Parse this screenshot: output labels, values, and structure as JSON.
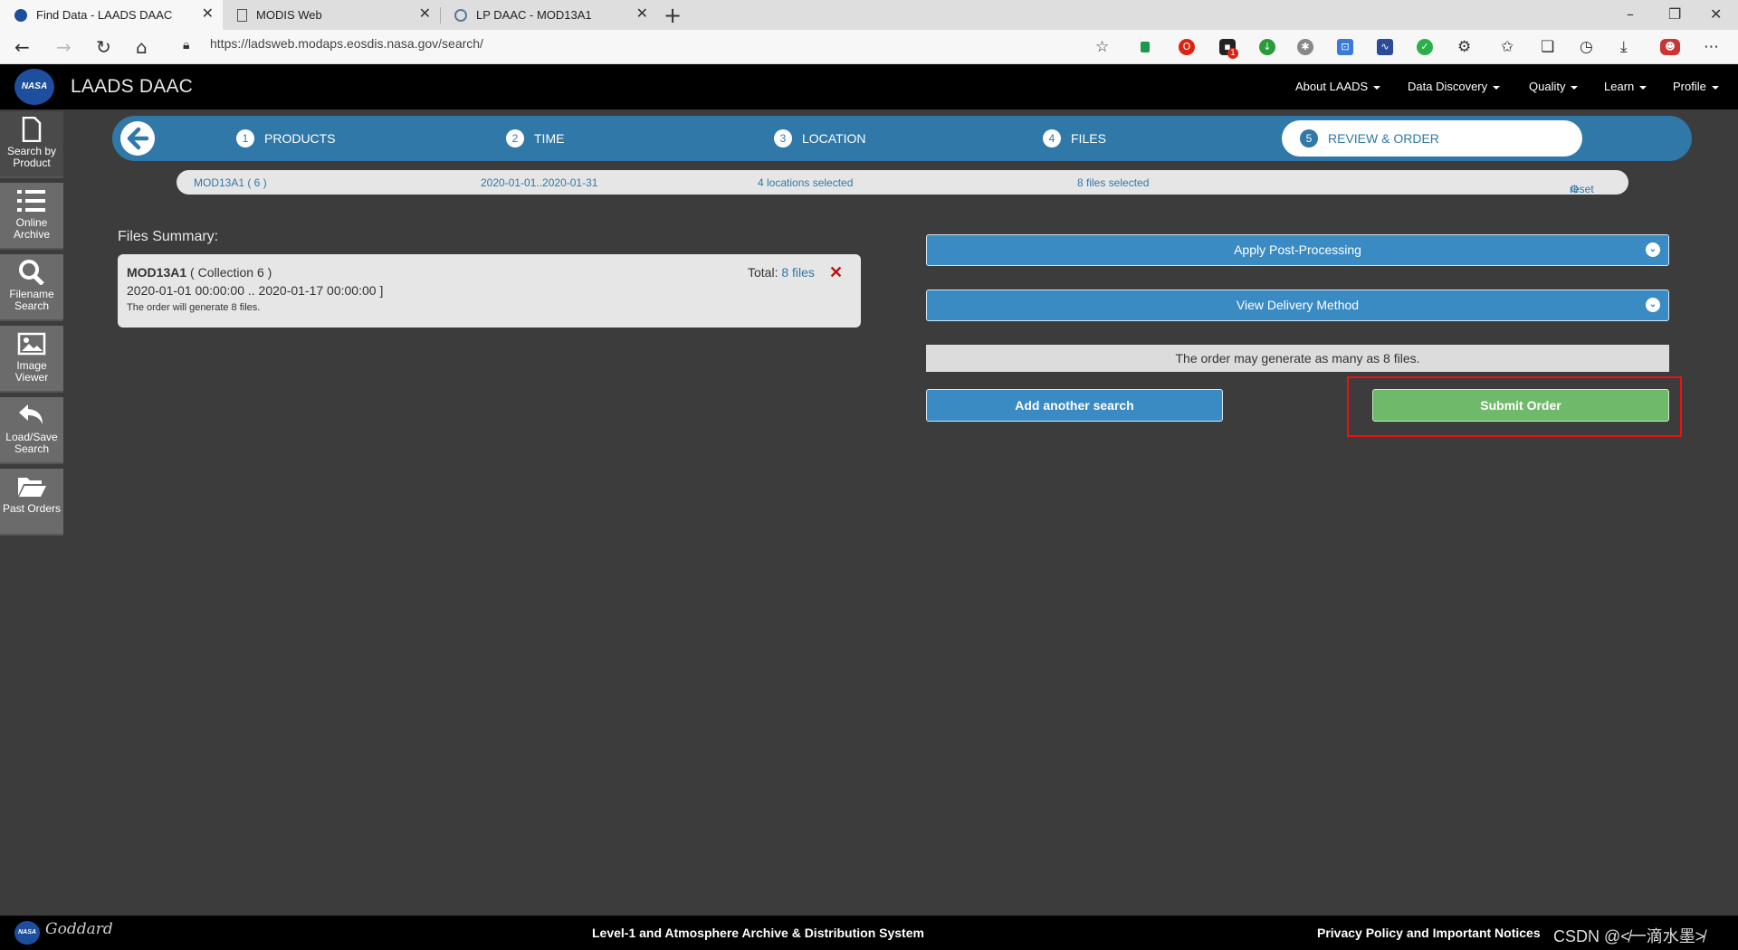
{
  "browser": {
    "tabs": [
      {
        "title": "Find Data - LAADS DAAC",
        "active": true
      },
      {
        "title": "MODIS Web",
        "active": false
      },
      {
        "title": "LP DAAC - MOD13A1",
        "active": false
      }
    ],
    "url": "https://ladsweb.modaps.eosdis.nasa.gov/search/",
    "ext_badge": "1"
  },
  "header": {
    "logo_text": "NASA",
    "title": "LAADS DAAC",
    "nav": [
      "About LAADS",
      "Data Discovery",
      "Quality",
      "Learn",
      "Profile"
    ]
  },
  "sidebar": {
    "items": [
      {
        "label": "Search by Product",
        "icon": "document-icon"
      },
      {
        "label": "Online Archive",
        "icon": "list-icon"
      },
      {
        "label": "Filename Search",
        "icon": "search-icon"
      },
      {
        "label": "Image Viewer",
        "icon": "image-icon"
      },
      {
        "label": "Load/Save Search",
        "icon": "undo-icon"
      },
      {
        "label": "Past Orders",
        "icon": "folder-icon"
      }
    ]
  },
  "steps": [
    {
      "num": "1",
      "label": "PRODUCTS"
    },
    {
      "num": "2",
      "label": "TIME"
    },
    {
      "num": "3",
      "label": "LOCATION"
    },
    {
      "num": "4",
      "label": "FILES"
    },
    {
      "num": "5",
      "label": "REVIEW & ORDER"
    }
  ],
  "summary": {
    "product": "MOD13A1 ( 6 )",
    "time": "2020-01-01..2020-01-31",
    "locations": "4 locations selected",
    "files": "8 files selected",
    "reset": "reset"
  },
  "files_summary": {
    "title": "Files Summary:",
    "product": "MOD13A1",
    "collection": "( Collection 6 )",
    "range": "2020-01-01 00:00:00 .. 2020-01-17 00:00:00 ]",
    "note": "The order will generate 8 files.",
    "total_label": "Total:",
    "total_link": "8 files"
  },
  "right": {
    "post_processing": "Apply Post-Processing",
    "delivery": "View Delivery Method",
    "order_note": "The order may generate as many as 8 files.",
    "add_search": "Add another search",
    "submit": "Submit Order"
  },
  "footer": {
    "logo_text": "NASA",
    "goddard": "Goddard",
    "center": "Level-1 and Atmosphere Archive & Distribution System",
    "privacy": "Privacy Policy and Important Notices",
    "watermark": "CSDN @≮一滴水墨≯"
  },
  "colors": {
    "accent": "#2f78a8",
    "button": "#3a8ac4",
    "submit": "#6fba6a",
    "highlight": "#ee1111"
  }
}
